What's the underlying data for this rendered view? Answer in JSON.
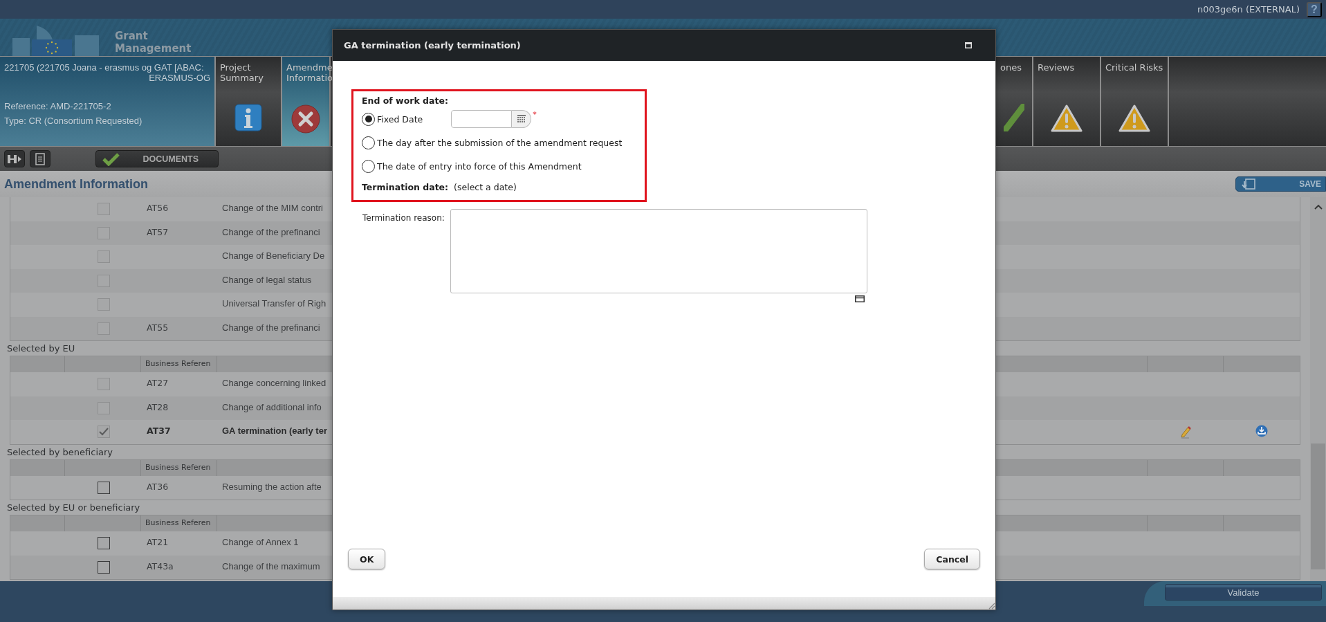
{
  "top_bar": {
    "user": "n003ge6n (EXTERNAL)",
    "help": "?"
  },
  "banner": {
    "app_name_1": "Grant",
    "app_name_2": "Management"
  },
  "project": {
    "line_1": "221705 (221705 Joana - erasmus og GAT [ABAC:",
    "line_2": "ERASMUS-OG",
    "reference": "Reference: AMD-221705-2",
    "type": "Type: CR (Consortium Requested)"
  },
  "tabs_left": [
    {
      "label": "Project Summary",
      "kind": "info",
      "selected": false
    },
    {
      "label": "Amendme Informatio",
      "kind": "error",
      "selected": true
    }
  ],
  "tabs_right": [
    {
      "label": "ones",
      "kind": "ok",
      "selected": false
    },
    {
      "label": "Reviews",
      "kind": "warning",
      "selected": false
    },
    {
      "label": "Critical Risks",
      "kind": "warning",
      "selected": false
    }
  ],
  "toolbar": {
    "documents": "DOCUMENTS"
  },
  "page_title": "Amendment Information",
  "save": "SAVE",
  "groups": [
    {
      "rows": [
        {
          "reference": "AT56",
          "description": "Change of the MIM contri",
          "checked": false,
          "disabled": true,
          "selected": false,
          "actions": false
        },
        {
          "reference": "AT57",
          "description": "Change of the prefinanci",
          "checked": false,
          "disabled": true,
          "selected": false,
          "actions": false
        },
        {
          "description": "Change of Beneficiary De",
          "checked": false,
          "disabled": true,
          "selected": false,
          "actions": false
        },
        {
          "description": "Change of legal status",
          "checked": false,
          "disabled": true,
          "selected": false,
          "actions": false
        },
        {
          "description": "Universal Transfer of Righ",
          "checked": false,
          "disabled": true,
          "selected": false,
          "actions": false
        },
        {
          "reference": "AT55",
          "description": "Change of the prefinanci",
          "checked": false,
          "disabled": true,
          "selected": false,
          "actions": false
        }
      ]
    },
    {
      "label": "Selected by EU",
      "column_header": "Business Referen",
      "rows": [
        {
          "reference": "AT27",
          "description": "Change concerning linked",
          "checked": false,
          "disabled": true,
          "selected": false,
          "actions": false
        },
        {
          "reference": "AT28",
          "description": "Change of additional info",
          "checked": false,
          "disabled": true,
          "selected": false,
          "actions": false
        },
        {
          "reference": "AT37",
          "description": "GA termination (early ter",
          "checked": true,
          "disabled": true,
          "selected": true,
          "actions": true
        }
      ]
    },
    {
      "label": "Selected by beneficiary",
      "column_header": "Business Referen",
      "rows": [
        {
          "reference": "AT36",
          "description": "Resuming the action afte",
          "checked": false,
          "disabled": false,
          "selected": false,
          "actions": false
        }
      ]
    },
    {
      "label": "Selected by EU or beneficiary",
      "column_header": "Business Referen",
      "rows": [
        {
          "reference": "AT21",
          "description": "Change of Annex 1",
          "checked": false,
          "disabled": false,
          "selected": false,
          "actions": false
        },
        {
          "reference": "AT43a",
          "description": "Change of the maximum",
          "checked": false,
          "disabled": false,
          "selected": false,
          "actions": false
        }
      ]
    }
  ],
  "validate": "Validate",
  "dialog": {
    "title": "GA termination (early termination)",
    "end_of_work_label": "End of work date:",
    "options": [
      {
        "label": "Fixed Date",
        "kind": "date",
        "selected": true
      },
      {
        "label": "The day after the submission of the amendment request",
        "kind": "plain",
        "selected": false
      },
      {
        "label": "The date of entry into force of this Amendment",
        "kind": "plain",
        "selected": false
      }
    ],
    "required_mark": "*",
    "termination_label": "Termination date:",
    "termination_value": "(select a date)",
    "reason_label": "Termination reason:",
    "buttons": [
      {
        "label": "OK"
      },
      {
        "label": "Cancel"
      }
    ]
  }
}
